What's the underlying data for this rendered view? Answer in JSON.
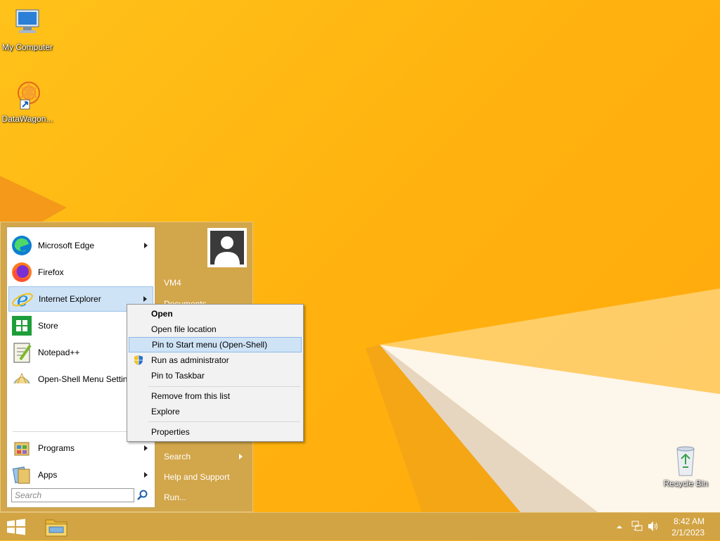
{
  "desktop": {
    "icons": [
      {
        "label": "My Computer",
        "icon": "computer-icon"
      },
      {
        "label": "DataWagon...",
        "icon": "datawagon-icon"
      },
      {
        "label": "Recycle Bin",
        "icon": "recycle-bin-icon"
      }
    ]
  },
  "start_menu": {
    "apps": [
      {
        "label": "Microsoft Edge",
        "icon": "edge-icon",
        "has_submenu": true
      },
      {
        "label": "Firefox",
        "icon": "firefox-icon",
        "has_submenu": false
      },
      {
        "label": "Internet Explorer",
        "icon": "internet-explorer-icon",
        "has_submenu": true
      },
      {
        "label": "Store",
        "icon": "store-icon",
        "has_submenu": false
      },
      {
        "label": "Notepad++",
        "icon": "notepadpp-icon",
        "has_submenu": false
      },
      {
        "label": "Open-Shell Menu Settings",
        "icon": "open-shell-icon",
        "has_submenu": false
      }
    ],
    "bottom": [
      {
        "label": "Programs",
        "icon": "programs-icon",
        "has_submenu": true
      },
      {
        "label": "Apps",
        "icon": "apps-icon",
        "has_submenu": true
      }
    ],
    "search_placeholder": "Search",
    "right": {
      "user": "VM4",
      "items": [
        {
          "label": "Documents"
        },
        {
          "label": "Search",
          "has_submenu": true
        },
        {
          "label": "Help and Support"
        },
        {
          "label": "Run..."
        }
      ]
    }
  },
  "context_menu": {
    "items": [
      {
        "label": "Open",
        "bold": true
      },
      {
        "label": "Open file location"
      },
      {
        "label": "Pin to Start menu (Open-Shell)",
        "highlighted": true
      },
      {
        "label": "Run as administrator",
        "icon": "uac-shield-icon"
      },
      {
        "label": "Pin to Taskbar"
      },
      {
        "label": "Remove from this list"
      },
      {
        "label": "Explore"
      },
      {
        "label": "Properties"
      }
    ]
  },
  "taskbar": {
    "time": "8:42 AM",
    "date": "2/1/2023"
  },
  "colors": {
    "wallpaper": "#ffb30f",
    "menu_accent": "#d2a64a",
    "selection": "#cfe3f6"
  }
}
